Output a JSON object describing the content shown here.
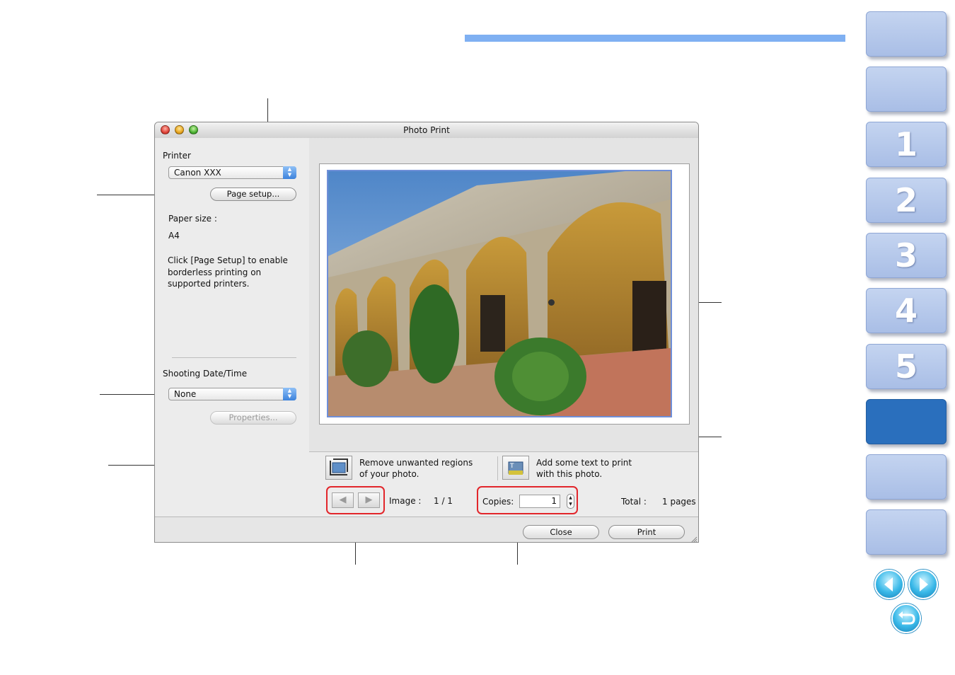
{
  "window": {
    "title": "Photo Print",
    "printer_label": "Printer",
    "printer_value": "Canon XXX",
    "page_setup_button": "Page setup...",
    "paper_size_label": "Paper size :",
    "paper_size_value": "A4",
    "hint_lines": [
      "Click [Page Setup] to enable",
      "borderless printing on",
      "supported printers."
    ],
    "shooting_label": "Shooting Date/Time",
    "shooting_value": "None",
    "properties_button": "Properties...",
    "trim_text_lines": [
      "Remove unwanted regions",
      "of your photo."
    ],
    "text_text_lines": [
      "Add some text to print",
      "with this photo."
    ],
    "image_label": "Image :",
    "image_value": "1 / 1",
    "copies_label": "Copies:",
    "copies_value": "1",
    "total_label": "Total :",
    "total_value": "1 pages",
    "close_button": "Close",
    "print_button": "Print"
  },
  "nav_tabs": [
    {
      "label": "",
      "active": false
    },
    {
      "label": "",
      "active": false
    },
    {
      "label": "1",
      "active": false
    },
    {
      "label": "2",
      "active": false
    },
    {
      "label": "3",
      "active": false
    },
    {
      "label": "4",
      "active": false
    },
    {
      "label": "5",
      "active": false
    },
    {
      "label": "",
      "active": true
    },
    {
      "label": "",
      "active": false
    },
    {
      "label": "",
      "active": false
    }
  ],
  "nav_buttons": {
    "prev": "previous-page-icon",
    "next": "next-page-icon",
    "back": "return-icon"
  },
  "colors": {
    "accent_bar": "#7fb0f2",
    "tab": "#b3c6ea",
    "tab_active": "#2a6fbd",
    "highlight_box": "#e2262b"
  }
}
